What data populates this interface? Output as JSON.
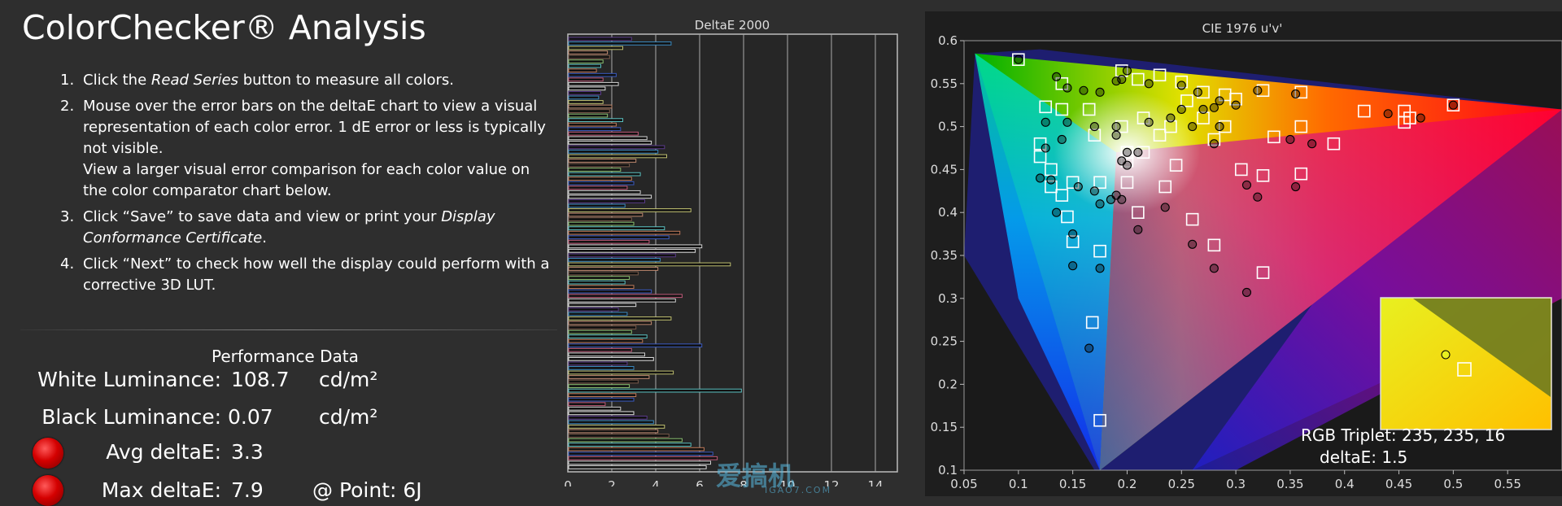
{
  "title": "ColorChecker® Analysis",
  "instructions": [
    {
      "num": "1.",
      "pre": "Click the ",
      "em": "Read Series",
      "post": " button to measure all colors."
    },
    {
      "num": "2.",
      "pre": "Mouse over the error bars on the deltaE chart to view a visual representation of each color error. 1 dE error or less is typically not visible.",
      "em": "",
      "post": "",
      "extra": "View a larger visual error comparison for each color value on the color comparator chart below."
    },
    {
      "num": "3.",
      "pre": "Click “Save” to save data and view or print your ",
      "em": "Display Conformance Certificate",
      "post": "."
    },
    {
      "num": "4.",
      "pre": "Click “Next” to check how well the display could perform with a corrective 3D LUT.",
      "em": "",
      "post": ""
    }
  ],
  "performance": {
    "title": "Performance Data",
    "white_label": "White Luminance:",
    "white_value": "108.7",
    "white_unit": "cd/m²",
    "black_label": "Black Luminance:",
    "black_value": "0.07",
    "black_unit": "cd/m²",
    "avg_label": "Avg deltaE:",
    "avg_value": "3.3",
    "max_label": "Max deltaE:",
    "max_value": "7.9",
    "point_label": "@ Point: 6J"
  },
  "chart_data": [
    {
      "type": "bar",
      "orientation": "horizontal",
      "title": "DeltaE 2000",
      "xlim": [
        0,
        15
      ],
      "xticks": [
        "0",
        "2",
        "4",
        "6",
        "8",
        "10",
        "12",
        "14"
      ],
      "reference_line": 2,
      "values": [
        2.9,
        4.7,
        2.5,
        1.8,
        1.9,
        1.6,
        1.5,
        1.3,
        2.2,
        1.6,
        2.3,
        1.7,
        1.5,
        1.4,
        1.6,
        2.0,
        1.9,
        1.8,
        2.5,
        2.2,
        2.4,
        3.2,
        3.6,
        3.8,
        4.4,
        4.1,
        4.5,
        3.1,
        2.8,
        2.4,
        3.3,
        2.9,
        3.0,
        2.7,
        3.3,
        3.8,
        3.5,
        2.6,
        5.6,
        3.4,
        2.9,
        3.0,
        4.4,
        5.1,
        4.6,
        3.7,
        6.1,
        5.8,
        4.9,
        4.2,
        7.4,
        4.1,
        3.2,
        2.8,
        2.6,
        3.0,
        3.8,
        5.2,
        4.9,
        3.1,
        2.3,
        2.7,
        4.7,
        3.8,
        3.1,
        2.9,
        3.6,
        3.4,
        6.1,
        2.9,
        3.5,
        3.9,
        2.7,
        3.0,
        4.8,
        3.7,
        3.2,
        2.8,
        7.9,
        3.1,
        3.0,
        1.7,
        2.4,
        3.0,
        3.6,
        3.9,
        4.4,
        4.1,
        4.6,
        5.2,
        5.6,
        6.2,
        6.6,
        6.8,
        6.5,
        6.3
      ]
    },
    {
      "type": "scatter",
      "title": "CIE 1976 u'v'",
      "xlim": [
        0.05,
        0.6
      ],
      "ylim": [
        0.1,
        0.6
      ],
      "xticks": [
        "0.05",
        "0.1",
        "0.15",
        "0.2",
        "0.25",
        "0.3",
        "0.35",
        "0.4",
        "0.45",
        "0.5",
        "0.55"
      ],
      "yticks": [
        "0.1",
        "0.15",
        "0.2",
        "0.25",
        "0.3",
        "0.35",
        "0.4",
        "0.45",
        "0.5",
        "0.55",
        "0.6"
      ],
      "target_squares": [
        [
          0.1,
          0.578
        ],
        [
          0.14,
          0.55
        ],
        [
          0.125,
          0.523
        ],
        [
          0.14,
          0.52
        ],
        [
          0.165,
          0.52
        ],
        [
          0.195,
          0.565
        ],
        [
          0.21,
          0.555
        ],
        [
          0.23,
          0.56
        ],
        [
          0.25,
          0.552
        ],
        [
          0.27,
          0.54
        ],
        [
          0.29,
          0.537
        ],
        [
          0.325,
          0.542
        ],
        [
          0.36,
          0.54
        ],
        [
          0.255,
          0.53
        ],
        [
          0.3,
          0.532
        ],
        [
          0.455,
          0.518
        ],
        [
          0.418,
          0.518
        ],
        [
          0.46,
          0.51
        ],
        [
          0.455,
          0.505
        ],
        [
          0.5,
          0.525
        ],
        [
          0.36,
          0.5
        ],
        [
          0.335,
          0.488
        ],
        [
          0.39,
          0.48
        ],
        [
          0.29,
          0.5
        ],
        [
          0.28,
          0.485
        ],
        [
          0.24,
          0.5
        ],
        [
          0.27,
          0.51
        ],
        [
          0.215,
          0.51
        ],
        [
          0.195,
          0.5
        ],
        [
          0.17,
          0.49
        ],
        [
          0.12,
          0.48
        ],
        [
          0.12,
          0.465
        ],
        [
          0.13,
          0.45
        ],
        [
          0.15,
          0.435
        ],
        [
          0.13,
          0.43
        ],
        [
          0.14,
          0.42
        ],
        [
          0.175,
          0.435
        ],
        [
          0.2,
          0.435
        ],
        [
          0.245,
          0.455
        ],
        [
          0.235,
          0.43
        ],
        [
          0.305,
          0.45
        ],
        [
          0.325,
          0.443
        ],
        [
          0.36,
          0.445
        ],
        [
          0.2,
          0.47
        ],
        [
          0.2,
          0.46
        ],
        [
          0.21,
          0.4
        ],
        [
          0.145,
          0.395
        ],
        [
          0.26,
          0.392
        ],
        [
          0.15,
          0.366
        ],
        [
          0.175,
          0.355
        ],
        [
          0.28,
          0.362
        ],
        [
          0.325,
          0.33
        ],
        [
          0.168,
          0.272
        ],
        [
          0.175,
          0.158
        ],
        [
          0.23,
          0.49
        ],
        [
          0.215,
          0.47
        ]
      ],
      "measured_points": [
        [
          0.1,
          0.578
        ],
        [
          0.135,
          0.558
        ],
        [
          0.145,
          0.545
        ],
        [
          0.16,
          0.542
        ],
        [
          0.175,
          0.54
        ],
        [
          0.19,
          0.553
        ],
        [
          0.195,
          0.555
        ],
        [
          0.22,
          0.55
        ],
        [
          0.25,
          0.548
        ],
        [
          0.265,
          0.54
        ],
        [
          0.285,
          0.53
        ],
        [
          0.3,
          0.525
        ],
        [
          0.32,
          0.542
        ],
        [
          0.355,
          0.538
        ],
        [
          0.25,
          0.52
        ],
        [
          0.27,
          0.52
        ],
        [
          0.28,
          0.522
        ],
        [
          0.24,
          0.51
        ],
        [
          0.22,
          0.505
        ],
        [
          0.26,
          0.5
        ],
        [
          0.285,
          0.5
        ],
        [
          0.35,
          0.485
        ],
        [
          0.37,
          0.48
        ],
        [
          0.44,
          0.515
        ],
        [
          0.47,
          0.51
        ],
        [
          0.5,
          0.525
        ],
        [
          0.28,
          0.48
        ],
        [
          0.125,
          0.505
        ],
        [
          0.145,
          0.505
        ],
        [
          0.125,
          0.475
        ],
        [
          0.14,
          0.485
        ],
        [
          0.17,
          0.5
        ],
        [
          0.19,
          0.49
        ],
        [
          0.2,
          0.47
        ],
        [
          0.195,
          0.46
        ],
        [
          0.2,
          0.455
        ],
        [
          0.21,
          0.47
        ],
        [
          0.13,
          0.438
        ],
        [
          0.155,
          0.43
        ],
        [
          0.17,
          0.425
        ],
        [
          0.19,
          0.42
        ],
        [
          0.195,
          0.415
        ],
        [
          0.185,
          0.415
        ],
        [
          0.175,
          0.41
        ],
        [
          0.12,
          0.44
        ],
        [
          0.135,
          0.4
        ],
        [
          0.15,
          0.375
        ],
        [
          0.15,
          0.338
        ],
        [
          0.175,
          0.335
        ],
        [
          0.21,
          0.38
        ],
        [
          0.235,
          0.406
        ],
        [
          0.26,
          0.363
        ],
        [
          0.31,
          0.432
        ],
        [
          0.32,
          0.418
        ],
        [
          0.355,
          0.43
        ],
        [
          0.28,
          0.335
        ],
        [
          0.31,
          0.307
        ],
        [
          0.165,
          0.242
        ],
        [
          0.2,
          0.565
        ],
        [
          0.19,
          0.5
        ]
      ],
      "inset": {
        "rgb_label": "RGB Triplet: 235, 235, 16",
        "deltae_label": "deltaE: 1.5"
      }
    }
  ],
  "watermark": "爱搞机",
  "watermark_sub": "IGAO7.COM",
  "colors": {
    "background": "#2e2e2e",
    "chart_panel": "#1e1e1e",
    "accent_red": "#d40000"
  }
}
